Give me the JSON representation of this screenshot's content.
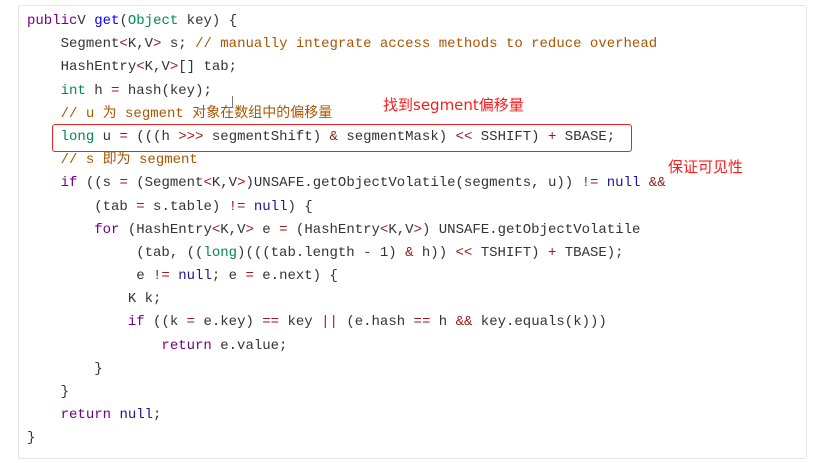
{
  "code_lines": [
    {
      "indent": 0,
      "tokens": [
        [
          "kw",
          "public"
        ],
        [
          "",
          "V "
        ],
        [
          "def",
          "get"
        ],
        [
          "",
          "("
        ],
        [
          "type",
          "Object"
        ],
        [
          "",
          " key) {"
        ]
      ]
    },
    {
      "indent": 4,
      "tokens": [
        [
          "",
          "Segment"
        ],
        [
          "op",
          "<"
        ],
        [
          "",
          "K,V"
        ],
        [
          "op",
          ">"
        ],
        [
          "",
          " s; "
        ],
        [
          "cm",
          "// manually integrate access methods to reduce overhead"
        ]
      ]
    },
    {
      "indent": 4,
      "tokens": [
        [
          "",
          "HashEntry"
        ],
        [
          "op",
          "<"
        ],
        [
          "",
          "K,V"
        ],
        [
          "op",
          ">"
        ],
        [
          "",
          "[] tab;"
        ]
      ]
    },
    {
      "indent": 4,
      "tokens": [
        [
          "type",
          "int"
        ],
        [
          "",
          " h "
        ],
        [
          "op",
          "="
        ],
        [
          "",
          " hash(key);"
        ]
      ]
    },
    {
      "indent": 4,
      "tokens": [
        [
          "cm",
          "// u 为 segment 对象在数组中的偏移量"
        ]
      ]
    },
    {
      "indent": 4,
      "tokens": [
        [
          "type",
          "long"
        ],
        [
          "",
          " u "
        ],
        [
          "op",
          "="
        ],
        [
          "",
          " (((h "
        ],
        [
          "op",
          ">>>"
        ],
        [
          "",
          " segmentShift) "
        ],
        [
          "op",
          "&"
        ],
        [
          "",
          " segmentMask) "
        ],
        [
          "op",
          "<<"
        ],
        [
          "",
          " SSHIFT) "
        ],
        [
          "op",
          "+"
        ],
        [
          "",
          " SBASE;"
        ]
      ]
    },
    {
      "indent": 4,
      "tokens": [
        [
          "cm",
          "// s 即为 segment"
        ]
      ]
    },
    {
      "indent": 4,
      "tokens": [
        [
          "kw",
          "if"
        ],
        [
          "",
          " ((s "
        ],
        [
          "op",
          "="
        ],
        [
          "",
          " (Segment"
        ],
        [
          "op",
          "<"
        ],
        [
          "",
          "K,V"
        ],
        [
          "op",
          ">"
        ],
        [
          "",
          ")UNSAFE.getObjectVolatile(segments, u)) "
        ],
        [
          "op",
          "!="
        ],
        [
          "",
          " "
        ],
        [
          "atom",
          "null"
        ],
        [
          "",
          " "
        ],
        [
          "op",
          "&&"
        ]
      ]
    },
    {
      "indent": 8,
      "tokens": [
        [
          "",
          "(tab "
        ],
        [
          "op",
          "="
        ],
        [
          "",
          " s.table) "
        ],
        [
          "op",
          "!="
        ],
        [
          "",
          " "
        ],
        [
          "atom",
          "null"
        ],
        [
          "",
          ") {"
        ]
      ]
    },
    {
      "indent": 8,
      "tokens": [
        [
          "kw",
          "for"
        ],
        [
          "",
          " (HashEntry"
        ],
        [
          "op",
          "<"
        ],
        [
          "",
          "K,V"
        ],
        [
          "op",
          ">"
        ],
        [
          "",
          " e "
        ],
        [
          "op",
          "="
        ],
        [
          "",
          " (HashEntry"
        ],
        [
          "op",
          "<"
        ],
        [
          "",
          "K,V"
        ],
        [
          "op",
          ">"
        ],
        [
          "",
          ") UNSAFE.getObjectVolatile"
        ]
      ]
    },
    {
      "indent": 13,
      "tokens": [
        [
          "",
          "(tab, (("
        ],
        [
          "type",
          "long"
        ],
        [
          "",
          ")(((tab.length "
        ],
        [
          "op",
          "-"
        ],
        [
          "",
          " 1) "
        ],
        [
          "op",
          "&"
        ],
        [
          "",
          " h)) "
        ],
        [
          "op",
          "<<"
        ],
        [
          "",
          " TSHIFT) "
        ],
        [
          "op",
          "+"
        ],
        [
          "",
          " TBASE);"
        ]
      ]
    },
    {
      "indent": 13,
      "tokens": [
        [
          "",
          "e "
        ],
        [
          "op",
          "!="
        ],
        [
          "",
          " "
        ],
        [
          "atom",
          "null"
        ],
        [
          "",
          "; e "
        ],
        [
          "op",
          "="
        ],
        [
          "",
          " e.next) {"
        ]
      ]
    },
    {
      "indent": 12,
      "tokens": [
        [
          "",
          "K k;"
        ]
      ]
    },
    {
      "indent": 12,
      "tokens": [
        [
          "kw",
          "if"
        ],
        [
          "",
          " ((k "
        ],
        [
          "op",
          "="
        ],
        [
          "",
          " e.key) "
        ],
        [
          "op",
          "=="
        ],
        [
          "",
          " key "
        ],
        [
          "op",
          "||"
        ],
        [
          "",
          " (e.hash "
        ],
        [
          "op",
          "=="
        ],
        [
          "",
          " h "
        ],
        [
          "op",
          "&&"
        ],
        [
          "",
          " key.equals(k)))"
        ]
      ]
    },
    {
      "indent": 16,
      "tokens": [
        [
          "kw",
          "return"
        ],
        [
          "",
          " e.value;"
        ]
      ]
    },
    {
      "indent": 8,
      "tokens": [
        [
          "",
          "}"
        ]
      ]
    },
    {
      "indent": 4,
      "tokens": [
        [
          "",
          "}"
        ]
      ]
    },
    {
      "indent": 4,
      "tokens": [
        [
          "kw",
          "return"
        ],
        [
          "",
          " "
        ],
        [
          "atom",
          "null"
        ],
        [
          "",
          ";"
        ]
      ]
    },
    {
      "indent": 0,
      "tokens": [
        [
          "",
          "}"
        ]
      ]
    }
  ],
  "annotations": {
    "offset_note": "找到segment偏移量",
    "visibility_note": "保证可见性"
  },
  "colors": {
    "annotation": "#ff1a1a",
    "keyword": "#770088",
    "comment": "#aa5500"
  }
}
